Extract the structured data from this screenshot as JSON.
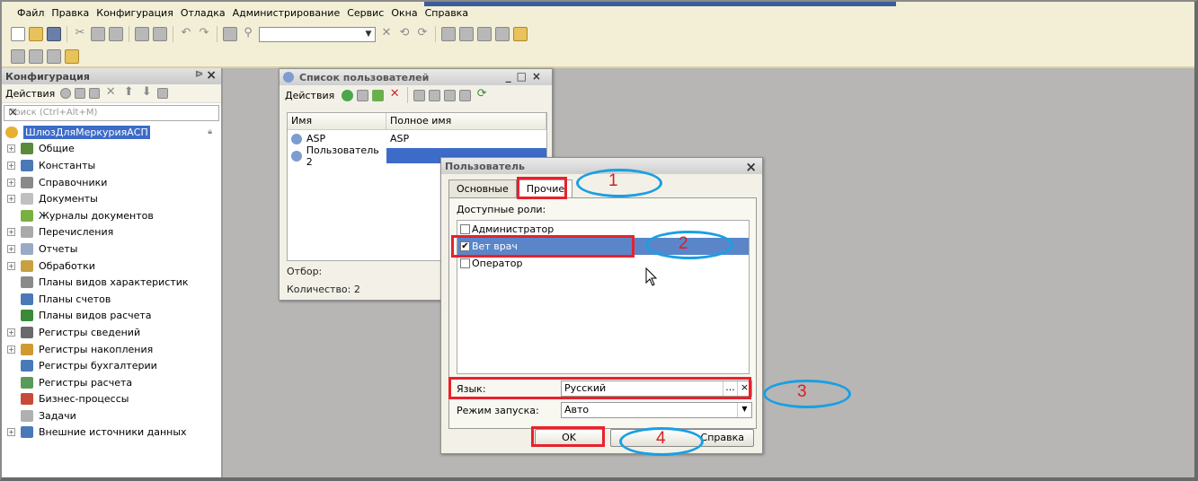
{
  "menu": [
    "Файл",
    "Правка",
    "Конфигурация",
    "Отладка",
    "Администрирование",
    "Сервис",
    "Окна",
    "Справка"
  ],
  "config_panel": {
    "title": "Конфигурация",
    "actions_label": "Действия",
    "search_placeholder": "Поиск (Ctrl+Alt+M)",
    "root": "ШлюзДляМеркурияАСП",
    "items": [
      {
        "label": "Общие",
        "expand": true,
        "color": "#5a8a3a"
      },
      {
        "label": "Константы",
        "expand": true,
        "color": "#4a79b8"
      },
      {
        "label": "Справочники",
        "expand": true,
        "color": "#8a8a8a"
      },
      {
        "label": "Документы",
        "expand": true,
        "color": "#c0c0c0"
      },
      {
        "label": "Журналы документов",
        "expand": false,
        "color": "#7ab040"
      },
      {
        "label": "Перечисления",
        "expand": true,
        "color": "#aaaaaa"
      },
      {
        "label": "Отчеты",
        "expand": true,
        "color": "#9aa9c5"
      },
      {
        "label": "Обработки",
        "expand": true,
        "color": "#c9a040"
      },
      {
        "label": "Планы видов характеристик",
        "expand": false,
        "color": "#8a8a8a"
      },
      {
        "label": "Планы счетов",
        "expand": false,
        "color": "#4a79b8"
      },
      {
        "label": "Планы видов расчета",
        "expand": false,
        "color": "#3a8a3a"
      },
      {
        "label": "Регистры сведений",
        "expand": true,
        "color": "#6a6a6a"
      },
      {
        "label": "Регистры накопления",
        "expand": true,
        "color": "#d09a30"
      },
      {
        "label": "Регистры бухгалтерии",
        "expand": false,
        "color": "#4a79b8"
      },
      {
        "label": "Регистры расчета",
        "expand": false,
        "color": "#5a9a5a"
      },
      {
        "label": "Бизнес-процессы",
        "expand": false,
        "color": "#c84a3a"
      },
      {
        "label": "Задачи",
        "expand": false,
        "color": "#b0b0b0"
      },
      {
        "label": "Внешние источники данных",
        "expand": true,
        "color": "#4a79b8"
      }
    ]
  },
  "user_list": {
    "title": "Список пользователей",
    "actions_label": "Действия",
    "col_name": "Имя",
    "col_fullname": "Полное имя",
    "rows": [
      {
        "name": "ASP",
        "fullname": "ASP"
      },
      {
        "name": "Пользователь 2",
        "fullname": ""
      }
    ],
    "filter_label": "Отбор:",
    "count_label": "Количество: 2"
  },
  "user_dialog": {
    "title": "Пользователь",
    "tab_main": "Основные",
    "tab_other": "Прочие",
    "roles_label": "Доступные роли:",
    "roles": [
      {
        "label": "Администратор",
        "checked": false,
        "selected": false
      },
      {
        "label": "Вет врач",
        "checked": true,
        "selected": true
      },
      {
        "label": "Оператор",
        "checked": false,
        "selected": false
      }
    ],
    "lang_label": "Язык:",
    "lang_value": "Русский",
    "mode_label": "Режим запуска:",
    "mode_value": "Авто",
    "ok": "OK",
    "help": "Справка"
  },
  "annotations": [
    "1",
    "2",
    "3",
    "4"
  ],
  "colors": {
    "marker_red": "#e8212b",
    "marker_blue": "#1a9fe3",
    "selection": "#5a86c9"
  }
}
